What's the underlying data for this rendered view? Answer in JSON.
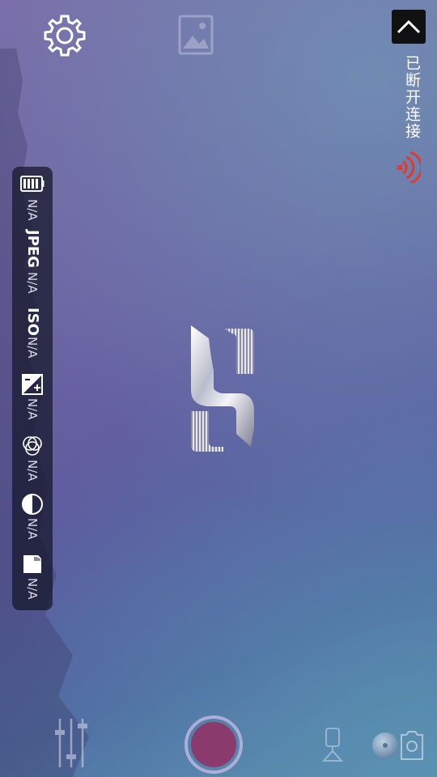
{
  "connection": {
    "status_text": "已断开连接"
  },
  "info_panel": {
    "battery_value": "N/A",
    "format_label": "JPEG",
    "format_value": "N/A",
    "iso_label": "ISO",
    "iso_value": "N/A",
    "ev_value": "N/A",
    "white_balance_value": "N/A",
    "metering_value": "N/A",
    "storage_value": "N/A"
  },
  "icons": {
    "settings": "gear-icon",
    "gallery": "image-gallery-icon",
    "collapse": "chevron-up-icon",
    "signal": "wifi-disconnected-icon",
    "battery": "battery-icon",
    "exposure": "exposure-compensation-icon",
    "white_balance": "white-balance-icon",
    "metering": "contrast-icon",
    "storage": "sd-card-icon",
    "adjust": "sliders-icon",
    "gimbal": "gimbal-icon",
    "record_switch": "camera-switch-icon"
  },
  "colors": {
    "accent_red": "#e23a2a",
    "shutter_fill": "#8b3a6d",
    "panel_bg": "#14162a"
  }
}
